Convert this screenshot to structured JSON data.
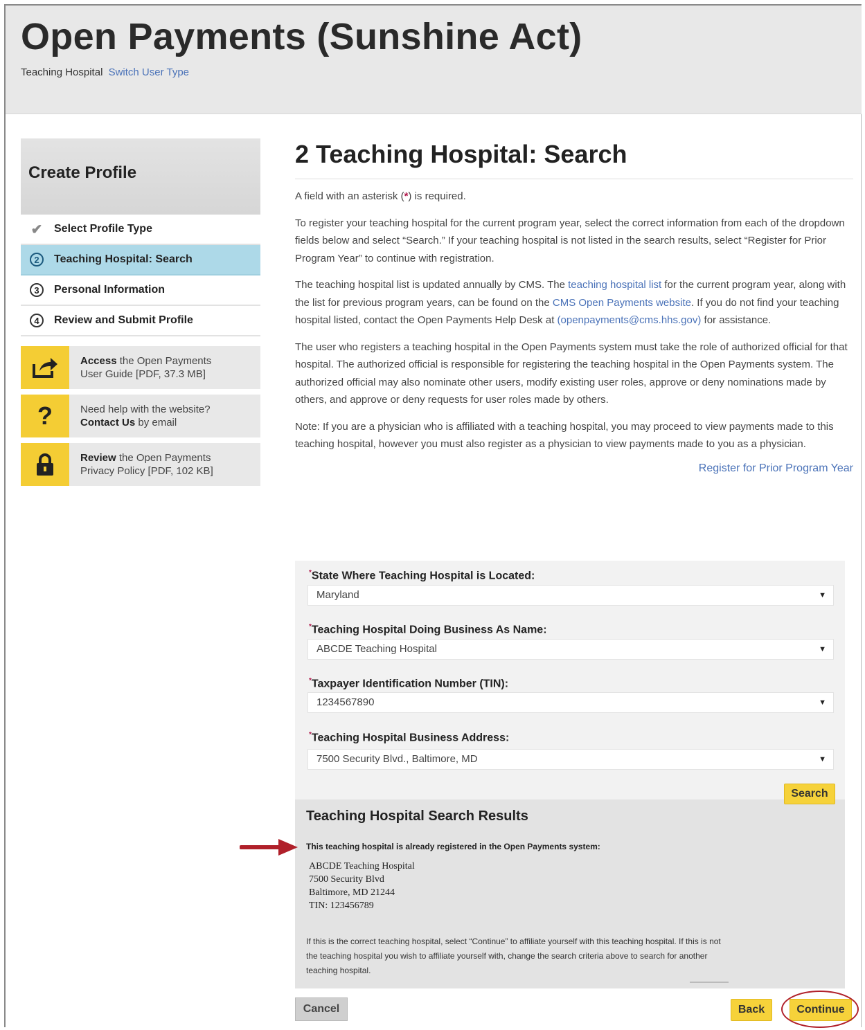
{
  "header": {
    "site_title": "Open Payments (Sunshine Act)",
    "user_type": "Teaching Hospital",
    "switch_link": "Switch User Type"
  },
  "sidebar": {
    "title": "Create Profile",
    "steps": [
      {
        "marker": "check",
        "label": "Select Profile Type"
      },
      {
        "marker": "2",
        "label": "Teaching Hospital: Search"
      },
      {
        "marker": "3",
        "label": "Personal Information"
      },
      {
        "marker": "4",
        "label": "Review and Submit Profile"
      }
    ],
    "help": [
      {
        "icon": "share-icon",
        "bold": "Access",
        "rest": " the Open Payments",
        "line2": "User Guide [PDF, 37.3 MB]"
      },
      {
        "icon": "question-icon",
        "line1": "Need help with the website?",
        "bold": "Contact Us",
        "rest": " by email"
      },
      {
        "icon": "lock-icon",
        "bold": "Review",
        "rest": " the Open Payments",
        "line2": "Privacy Policy [PDF, 102 KB]"
      }
    ]
  },
  "main": {
    "title": "2 Teaching Hospital: Search",
    "required_note_pre": "A field with an asterisk (",
    "required_note_star": "*",
    "required_note_post": ") is required.",
    "para1": "To register your teaching hospital for the current program year, select the correct information from each of the dropdown fields below and select “Search.” If your teaching hospital is not listed in the search results, select “Register for Prior Program Year” to continue with registration.",
    "para2_a": "The teaching hospital list is updated annually by CMS. The ",
    "para2_link1": "teaching hospital list",
    "para2_b": " for the current program year, along with the list for previous program years, can be found on the ",
    "para2_link2": "CMS Open Payments website",
    "para2_c": ". If you do not find your teaching hospital listed, contact the Open Payments Help Desk at ",
    "para2_link3": "(openpayments@cms.hhs.gov)",
    "para2_d": " for assistance.",
    "para3": "The user who registers a teaching hospital in the Open Payments system must take the role of authorized official for that hospital. The authorized official is responsible for registering the teaching hospital in the Open Payments system. The authorized official may also nominate other users, modify existing user roles, approve or deny nominations made by others, and approve or deny requests for user roles made by others.",
    "para4": "Note: If you are a physician who is affiliated with a teaching hospital, you may proceed to view payments made to this teaching hospital, however you must also register as a physician to view payments made to you as a physician.",
    "prior_year_link": "Register for Prior Program Year"
  },
  "form": {
    "fields": [
      {
        "label": "State Where Teaching Hospital is Located:",
        "value": "Maryland"
      },
      {
        "label": "Teaching Hospital Doing Business As Name:",
        "value": "ABCDE Teaching Hospital"
      },
      {
        "label": "Taxpayer Identification Number (TIN):",
        "value": "1234567890"
      },
      {
        "label": "Teaching Hospital Business Address:",
        "value": "7500 Security Blvd., Baltimore, MD"
      }
    ],
    "search_button": "Search"
  },
  "results": {
    "title": "Teaching Hospital Search Results",
    "already_registered": "This teaching hospital is already registered in the Open Payments system:",
    "address_lines": [
      "ABCDE Teaching Hospital",
      "7500 Security Blvd",
      "Baltimore, MD 21244",
      "TIN: 123456789"
    ],
    "instructions": "If this is the correct teaching hospital, select “Continue” to affiliate yourself with this teaching hospital. If this is not the teaching hospital you wish to affiliate yourself with, change the search criteria above to search for another teaching hospital."
  },
  "footer_buttons": {
    "cancel": "Cancel",
    "back": "Back",
    "continue": "Continue"
  },
  "colors": {
    "accent_yellow": "#f6d23a",
    "active_step": "#add9e8",
    "link": "#4a72b8",
    "annotation_red": "#b0202a"
  }
}
